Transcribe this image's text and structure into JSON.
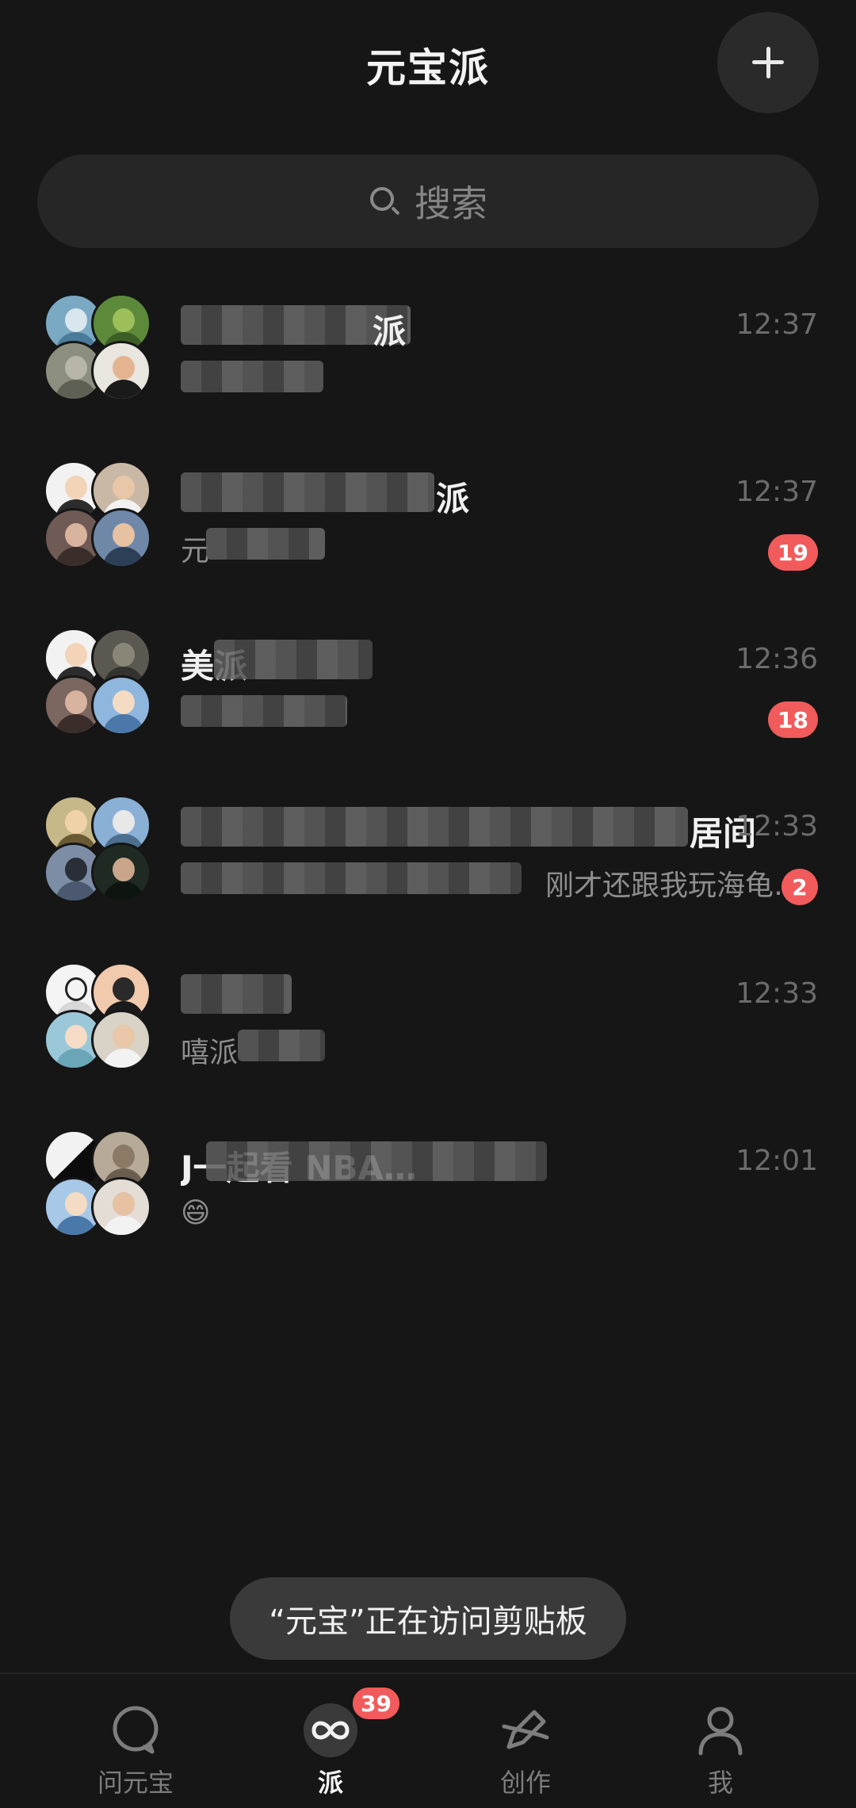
{
  "header": {
    "title": "元宝派",
    "add_icon": "plus-icon"
  },
  "search": {
    "icon": "search-icon",
    "placeholder": "搜索"
  },
  "chats": [
    {
      "name": "派",
      "preview": "",
      "time": "12:37",
      "badge": "",
      "avatar_colors": [
        "#7aa9c4",
        "#5c8a3a",
        "#8c8e80",
        "#e9e5df"
      ]
    },
    {
      "name": "派",
      "preview": "元",
      "time": "12:37",
      "badge": "19",
      "avatar_colors": [
        "#f2f2f2",
        "#c9b8a5",
        "#6f5a55",
        "#6f88a8"
      ]
    },
    {
      "name": "美派",
      "preview": "",
      "time": "12:36",
      "badge": "18",
      "avatar_colors": [
        "#f2f2f2",
        "#5a5850",
        "#7b6660",
        "#8fb6dd"
      ]
    },
    {
      "name": "居间",
      "preview": "刚才还跟我玩海龟…",
      "time": "12:33",
      "badge": "2",
      "avatar_colors": [
        "#c6b889",
        "#8ab0d6",
        "#7d8da6",
        "#1f2a22"
      ]
    },
    {
      "name": "",
      "preview": "嘻派",
      "time": "12:33",
      "badge": "",
      "avatar_colors": [
        "#f4f4f4",
        "#f1c9ad",
        "#9bc8d8",
        "#d9d2c6"
      ]
    },
    {
      "name": "J一起看 NBA…",
      "preview": "😄",
      "time": "12:01",
      "badge": "",
      "avatar_colors": [
        "#0c0c0c",
        "#b7aa99",
        "#a8c8e8",
        "#e3ddd6"
      ]
    }
  ],
  "toast": {
    "text": "“元宝”正在访问剪贴板"
  },
  "nav": {
    "items": [
      {
        "label": "问元宝",
        "icon": "chat-bubble-icon",
        "active": false
      },
      {
        "label": "派",
        "icon": "infinity-icon",
        "active": true,
        "badge": "39"
      },
      {
        "label": "创作",
        "icon": "pen-icon",
        "active": false
      },
      {
        "label": "我",
        "icon": "person-icon",
        "active": false
      }
    ]
  },
  "colors": {
    "background": "#161616",
    "badge": "#f25b5b",
    "text_muted": "#8e8e8e"
  }
}
